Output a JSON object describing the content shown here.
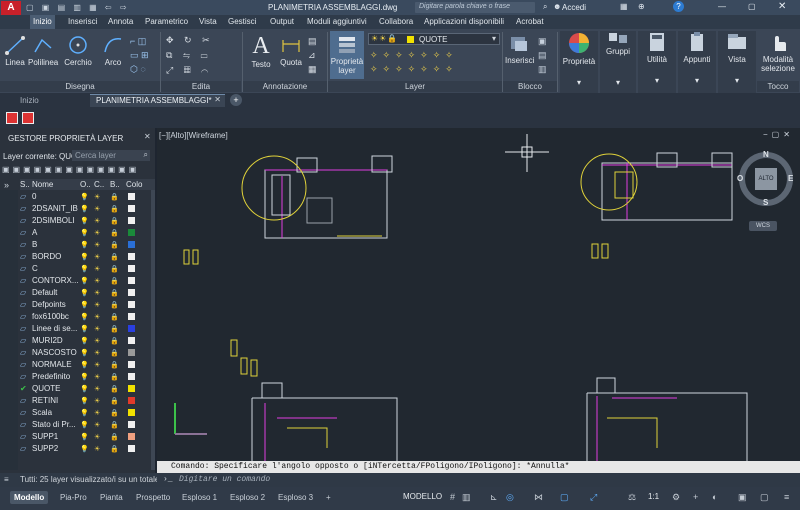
{
  "titlebar": {
    "file_title": "PLANIMETRIA ASSEMBLAGGI.dwg",
    "search_placeholder": "Digitare parola chiave o frase",
    "signin": "Accedi"
  },
  "menubar": {
    "items": [
      "Inizio",
      "Inserisci",
      "Annota",
      "Parametrico",
      "Vista",
      "Gestisci",
      "Output",
      "Moduli aggiuntivi",
      "Collabora",
      "Applicazioni disponibili",
      "Acrobat"
    ]
  },
  "ribbon": {
    "draw": {
      "line": "Linea",
      "polyline": "Polilinea",
      "circle": "Cerchio",
      "arc": "Arco",
      "panel": "Disegna"
    },
    "modify": {
      "panel": "Edita"
    },
    "annotation": {
      "text": "Testo",
      "dimension": "Quota",
      "panel": "Annotazione"
    },
    "layers": {
      "props_line1": "Proprietà",
      "props_line2": "layer",
      "current_layer": "QUOTE",
      "panel": "Layer"
    },
    "block": {
      "insert": "Inserisci",
      "panel": "Blocco"
    },
    "properties": {
      "label": "Proprietà"
    },
    "groups": {
      "label": "Gruppi"
    },
    "utilities": {
      "label": "Utilità"
    },
    "clipboard": {
      "label": "Appunti"
    },
    "view": {
      "label": "Vista"
    },
    "touch": {
      "mode_line1": "Modalità",
      "mode_line2": "selezione",
      "panel": "Tocco"
    }
  },
  "filetabs": {
    "start": "Inizio",
    "current": "PLANIMETRIA ASSEMBLAGGI*"
  },
  "layer_panel": {
    "title": "GESTORE PROPRIETÀ LAYER",
    "current_label": "Layer corrente: QUO",
    "search_placeholder": "Cerca layer",
    "col_status": "S..",
    "col_name": "Nome",
    "col_o": "O..",
    "col_c": "C..",
    "col_b": "B..",
    "col_color": "Colo",
    "layers": [
      {
        "name": "0",
        "color": "#f0f0f0"
      },
      {
        "name": "2DSANIT_IB",
        "color": "#f0f0f0"
      },
      {
        "name": "2DSIMBOLI",
        "color": "#f0f0f0"
      },
      {
        "name": "A",
        "color": "#1a8a3a"
      },
      {
        "name": "B",
        "color": "#2a6fd6"
      },
      {
        "name": "BORDO",
        "color": "#f0f0f0"
      },
      {
        "name": "C",
        "color": "#f0f0f0"
      },
      {
        "name": "CONTORX...",
        "color": "#f0f0f0"
      },
      {
        "name": "Default",
        "color": "#f0f0f0"
      },
      {
        "name": "Defpoints",
        "color": "#f0f0f0"
      },
      {
        "name": "fox6100bc",
        "color": "#f0f0f0"
      },
      {
        "name": "Linee di se...",
        "color": "#2a3fe0"
      },
      {
        "name": "MURI2D",
        "color": "#f0f0f0"
      },
      {
        "name": "NASCOSTO",
        "color": "#9a9a9a"
      },
      {
        "name": "NORMALE",
        "color": "#f0f0f0"
      },
      {
        "name": "Predefinito",
        "color": "#f0f0f0"
      },
      {
        "name": "QUOTE",
        "color": "#f2e200"
      },
      {
        "name": "RETINI",
        "color": "#e23a2a"
      },
      {
        "name": "Scala",
        "color": "#f2e200"
      },
      {
        "name": "Stato di Pr...",
        "color": "#f0f0f0"
      },
      {
        "name": "SUPP1",
        "color": "#f0a080"
      },
      {
        "name": "SUPP2",
        "color": "#f0f0f0"
      }
    ]
  },
  "canvas": {
    "viewport_label": "[−][Alto][Wireframe]",
    "viewcube": {
      "face": "ALTO",
      "north": "N",
      "south": "S",
      "east": "E",
      "west": "O",
      "wcs": "WCS"
    }
  },
  "command": {
    "history": "Comando: Specificare l'angolo opposto o [iNTercetta/FPoligono/IPoligono]: *Annulla*",
    "input_placeholder": "Digitare un comando"
  },
  "status_left": "Tutti: 25 layer visualizzato/i su un totale",
  "layout_tabs": [
    "Modello",
    "Pia-Pro",
    "Pianta",
    "Prospetto",
    "Esploso 1",
    "Esploso 2",
    "Esploso 3"
  ],
  "statusbar": {
    "model": "MODELLO",
    "scale": "1:1"
  },
  "colors": {
    "accent_red": "#c8202a",
    "magenta": "#e03ee0",
    "yellow": "#e0d23a"
  }
}
